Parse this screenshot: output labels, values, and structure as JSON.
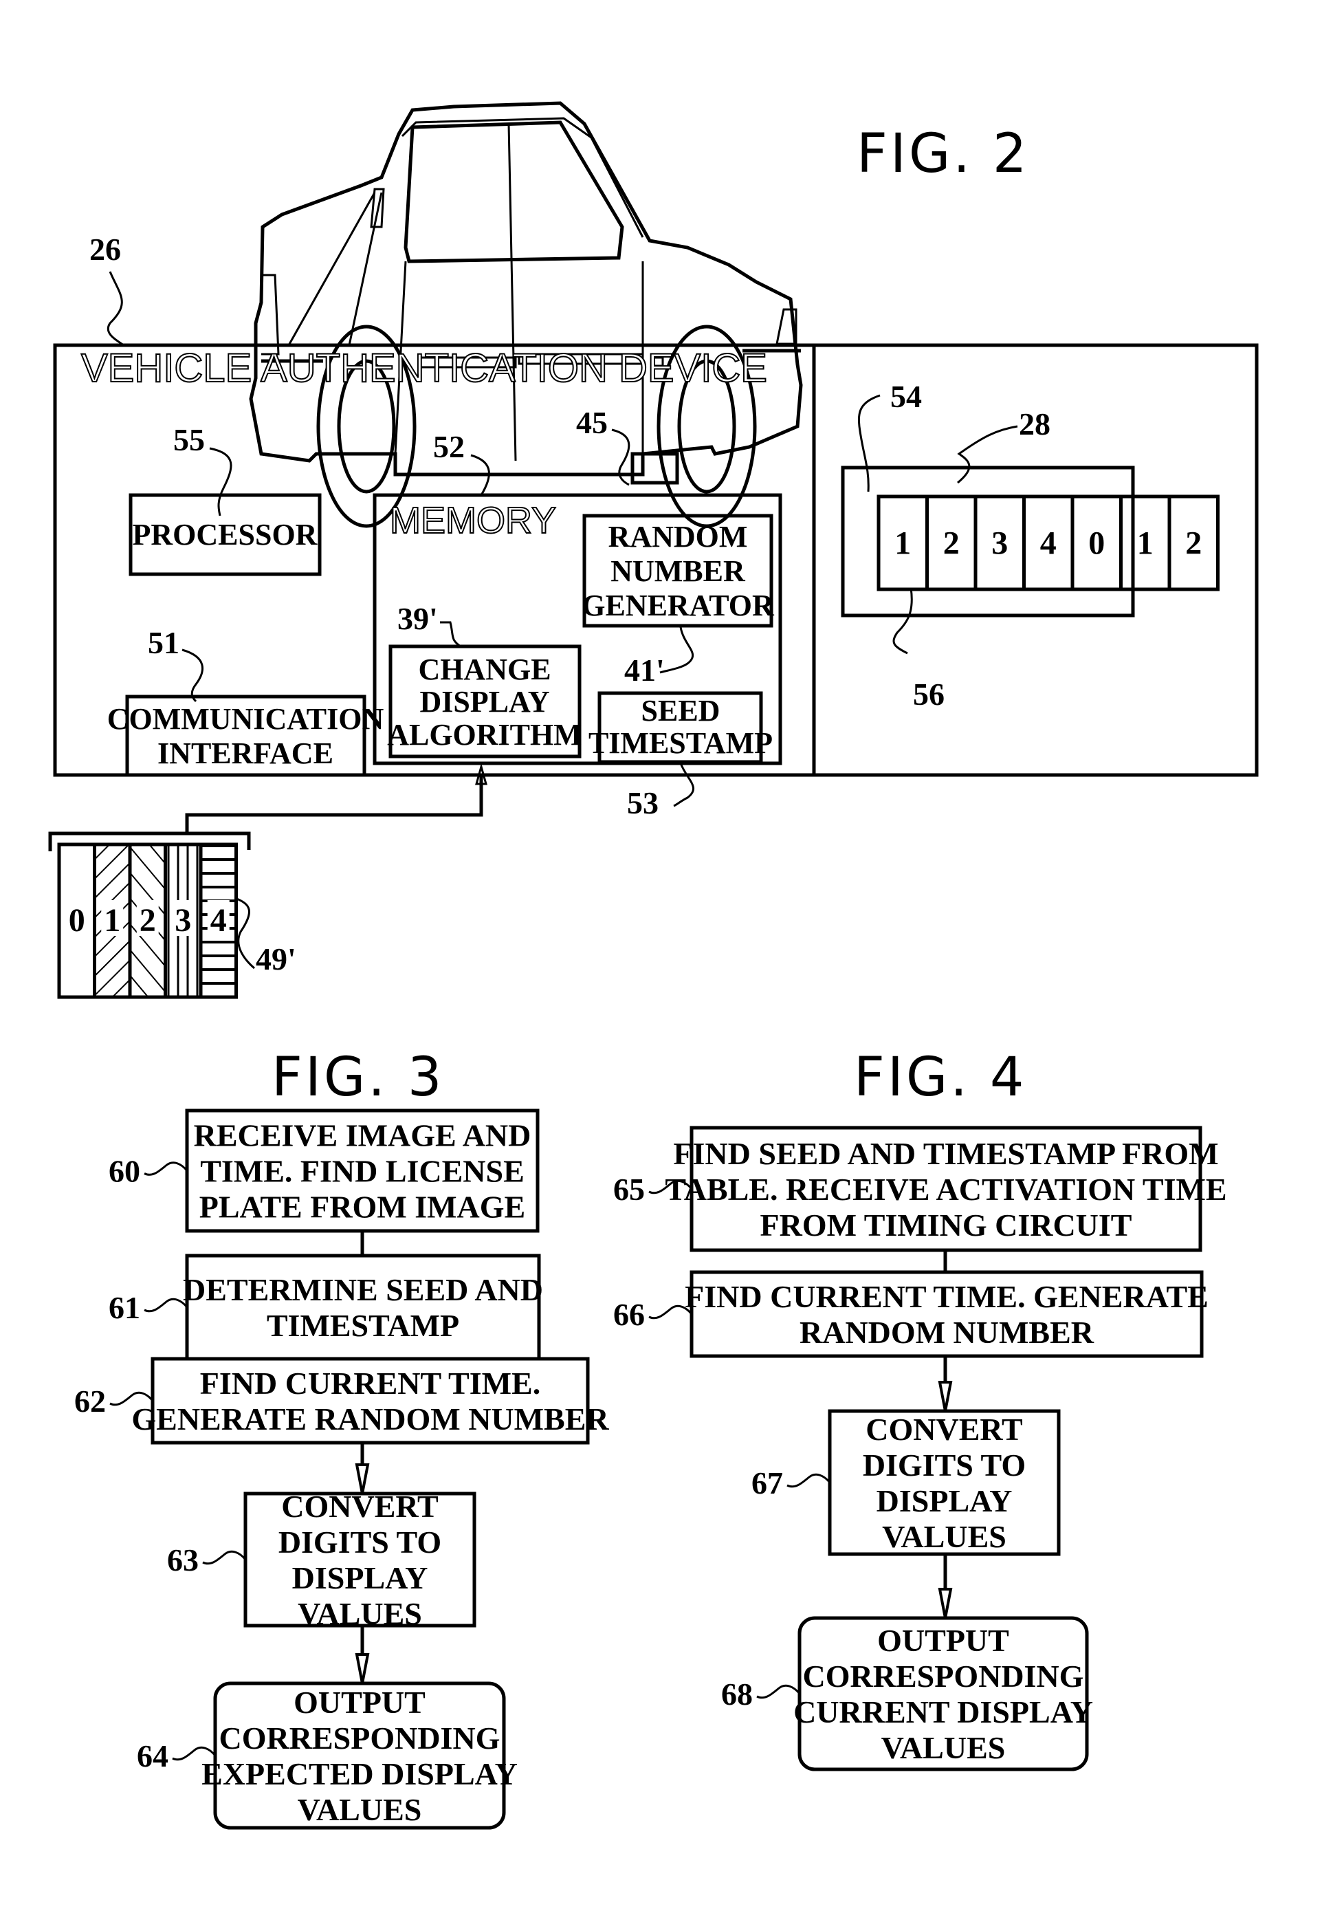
{
  "figures": {
    "fig2": {
      "title": "FIG. 2",
      "ref_device": "26",
      "device_title": "VEHICLE AUTHENTICATION DEVICE",
      "processor": {
        "ref": "55",
        "label": "PROCESSOR"
      },
      "memory": {
        "ref": "52",
        "label": "MEMORY"
      },
      "sensor": {
        "ref": "45"
      },
      "rng": {
        "ref": "41'",
        "lines": [
          "RANDOM",
          "NUMBER",
          "GENERATOR"
        ]
      },
      "algorithm": {
        "ref": "39'",
        "lines": [
          "CHANGE",
          "DISPLAY",
          "ALGORITHM"
        ]
      },
      "seed": {
        "ref": "53",
        "lines": [
          "SEED",
          "TIMESTAMP"
        ]
      },
      "comm": {
        "ref": "51",
        "lines": [
          "COMMUNICATION",
          "INTERFACE"
        ]
      },
      "plate": {
        "ref_plate": "28",
        "ref_frame": "54",
        "ref_cell": "56",
        "digits": [
          "1",
          "2",
          "3",
          "4",
          "0",
          "1",
          "2"
        ]
      },
      "legend": {
        "ref": "49'",
        "digits": [
          "0",
          "1",
          "2",
          "3",
          "4"
        ]
      }
    },
    "fig3": {
      "title": "FIG. 3",
      "steps": [
        {
          "ref": "60",
          "lines": [
            "RECEIVE IMAGE AND",
            "TIME. FIND LICENSE",
            "PLATE FROM IMAGE"
          ]
        },
        {
          "ref": "61",
          "lines": [
            "DETERMINE SEED AND",
            "TIMESTAMP"
          ]
        },
        {
          "ref": "62",
          "lines": [
            "FIND CURRENT TIME.",
            "GENERATE RANDOM NUMBER"
          ]
        },
        {
          "ref": "63",
          "lines": [
            "CONVERT",
            "DIGITS TO",
            "DISPLAY",
            "VALUES"
          ]
        },
        {
          "ref": "64",
          "lines": [
            "OUTPUT",
            "CORRESPONDING",
            "EXPECTED DISPLAY",
            "VALUES"
          ]
        }
      ]
    },
    "fig4": {
      "title": "FIG. 4",
      "steps": [
        {
          "ref": "65",
          "lines": [
            "FIND SEED AND TIMESTAMP FROM",
            "TABLE. RECEIVE ACTIVATION TIME",
            "FROM TIMING CIRCUIT"
          ]
        },
        {
          "ref": "66",
          "lines": [
            "FIND CURRENT TIME. GENERATE",
            "RANDOM NUMBER"
          ]
        },
        {
          "ref": "67",
          "lines": [
            "CONVERT",
            "DIGITS TO",
            "DISPLAY",
            "VALUES"
          ]
        },
        {
          "ref": "68",
          "lines": [
            "OUTPUT",
            "CORRESPONDING",
            "CURRENT DISPLAY",
            "VALUES"
          ]
        }
      ]
    }
  }
}
